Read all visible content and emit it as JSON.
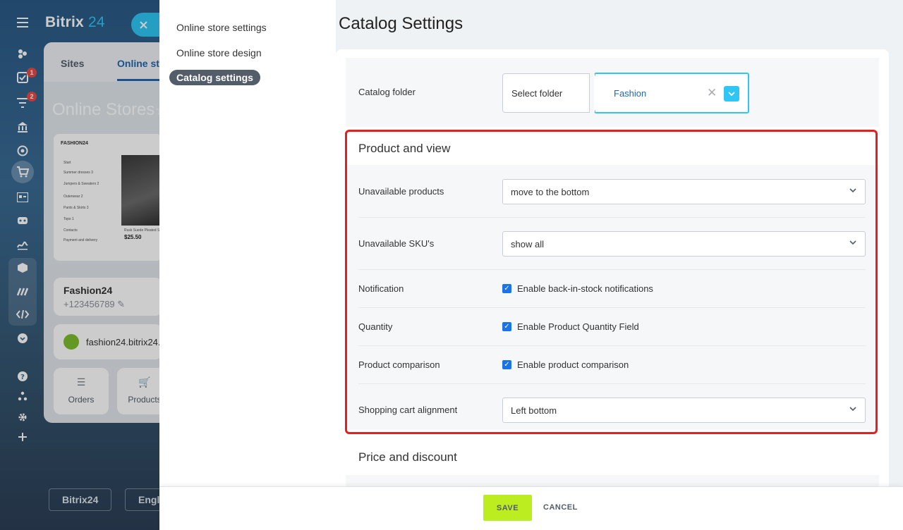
{
  "background": {
    "logo": "Bitrix",
    "logo_num": "24",
    "rail_badges": [
      "1",
      "2"
    ],
    "tabs": [
      "Sites",
      "Online st"
    ],
    "title": "Online Stores",
    "preview": {
      "brand": "FASHION24",
      "menu": [
        "Start",
        "Summer dresses 3",
        "Jumpers & Sweaters 2",
        "Outerwear 2",
        "Pants & Skirts 3",
        "Tops 1",
        "Contacts",
        "Payment and delivery"
      ],
      "product": "Rusk Suede Pleated Sk",
      "price": "$25.50"
    },
    "store_name": "Fashion24",
    "phone": "+123456789",
    "domain": "fashion24.bitrix24.",
    "tiles": [
      "Orders",
      "Products"
    ],
    "footer_buttons": [
      "Bitrix24",
      "Englis"
    ]
  },
  "nav": {
    "items": [
      "Online store settings",
      "Online store design",
      "Catalog settings"
    ]
  },
  "page": {
    "title": "Catalog Settings"
  },
  "catalog_folder": {
    "label": "Catalog folder",
    "select_label": "Select folder",
    "value": "Fashion"
  },
  "product_view": {
    "title": "Product and view",
    "unavailable_products": {
      "label": "Unavailable products",
      "value": "move to the bottom"
    },
    "unavailable_skus": {
      "label": "Unavailable SKU's",
      "value": "show all"
    },
    "notification": {
      "label": "Notification",
      "checkbox": "Enable back-in-stock notifications",
      "checked": true
    },
    "quantity": {
      "label": "Quantity",
      "checkbox": "Enable Product Quantity Field",
      "checked": true
    },
    "comparison": {
      "label": "Product comparison",
      "checkbox": "Enable product comparison",
      "checked": true
    },
    "cart_alignment": {
      "label": "Shopping cart alignment",
      "value": "Left bottom"
    }
  },
  "price_discount": {
    "title": "Price and discount"
  },
  "footer": {
    "save": "SAVE",
    "cancel": "CANCEL"
  },
  "colors": {
    "accent": "#2fc6f6",
    "save_bg": "#bbed21",
    "highlight": "#e31f1f",
    "checkbox": "#1a73e8"
  }
}
